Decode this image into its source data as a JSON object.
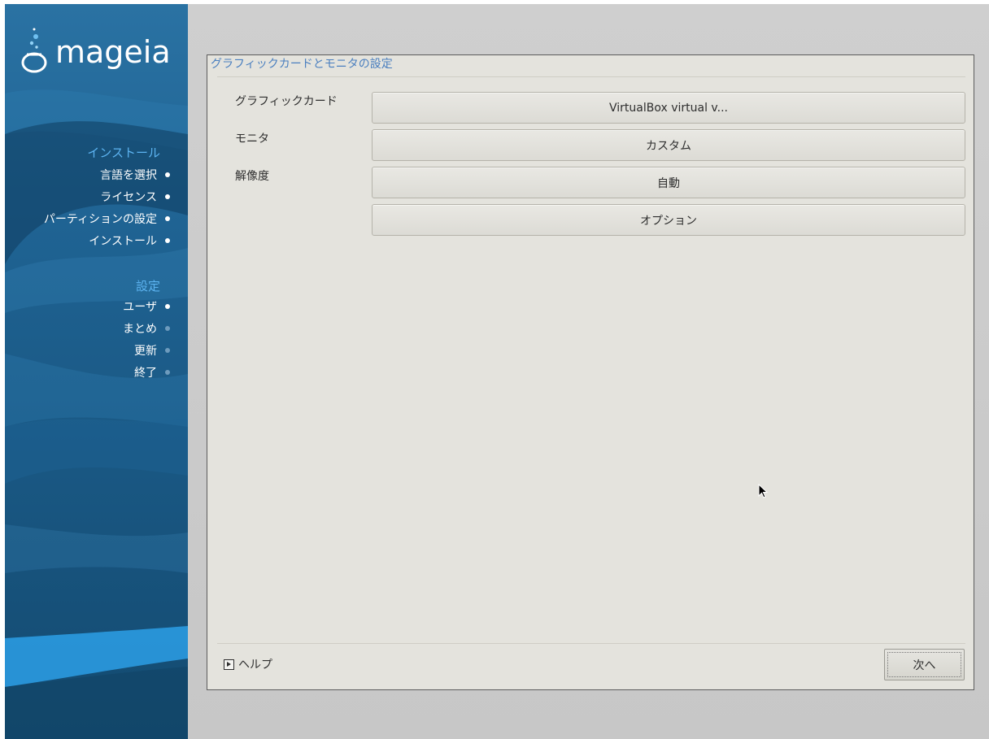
{
  "brand": {
    "logo_text": "mageia"
  },
  "sidebar": {
    "sections": [
      {
        "title": "インストール",
        "steps": [
          {
            "label": "言語を選択",
            "done": true
          },
          {
            "label": "ライセンス",
            "done": true
          },
          {
            "label": "パーティションの設定",
            "done": true
          },
          {
            "label": "インストール",
            "done": true
          }
        ]
      },
      {
        "title": "設定",
        "steps": [
          {
            "label": "ユーザ",
            "done": true
          },
          {
            "label": "まとめ",
            "done": false
          },
          {
            "label": "更新",
            "done": false
          },
          {
            "label": "終了",
            "done": false
          }
        ]
      }
    ]
  },
  "panel": {
    "title": "グラフィックカードとモニタの設定",
    "rows": [
      {
        "label": "グラフィックカード",
        "value": "VirtualBox virtual v..."
      },
      {
        "label": "モニタ",
        "value": "カスタム"
      },
      {
        "label": "解像度",
        "value": "自動"
      }
    ],
    "options_label": "オプション"
  },
  "footer": {
    "help_label": "ヘルプ",
    "next_label": "次へ"
  },
  "colors": {
    "sidebar_bg": "#1a5a86",
    "accent_blue": "#4a7fbf",
    "section_title": "#5cb3f0",
    "panel_bg": "#e4e3dd"
  }
}
